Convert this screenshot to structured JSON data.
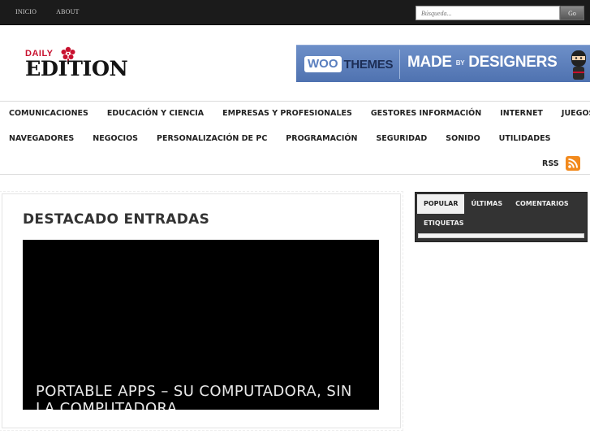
{
  "topbar": {
    "nav": [
      "Inicio",
      "About"
    ],
    "search_placeholder": "Búsqueda...",
    "search_button": "Go"
  },
  "header": {
    "logo_top": "DAILY",
    "logo_main": "EDITION",
    "banner": {
      "woo": "WOO",
      "themes": "THEMES",
      "made": "MADE",
      "by": "BY",
      "designers": "DESIGNERS"
    }
  },
  "nav": {
    "row1": [
      "Comunicaciones",
      "Educación y Ciencia",
      "Empresas y Profesionales",
      "Gestores información",
      "Internet",
      "Juegos"
    ],
    "row2": [
      "Navegadores",
      "Negocios",
      "Personalización de PC",
      "Programación",
      "Seguridad",
      "Sonido",
      "Utilidades"
    ],
    "rss": "RSS"
  },
  "main": {
    "heading": "Destacado Entradas",
    "feature_title": "Portable Apps – Su computadora, sin la computadora"
  },
  "sidebar": {
    "tabs": [
      "Popular",
      "Últimas",
      "Comentarios",
      "Etiquetas"
    ],
    "active_tab": "Popular"
  },
  "colors": {
    "topbar": "#1b1b1b",
    "logo_red": "#c8102e",
    "banner_blue": "#5a7dbd",
    "rss_orange": "#f28a1e"
  }
}
